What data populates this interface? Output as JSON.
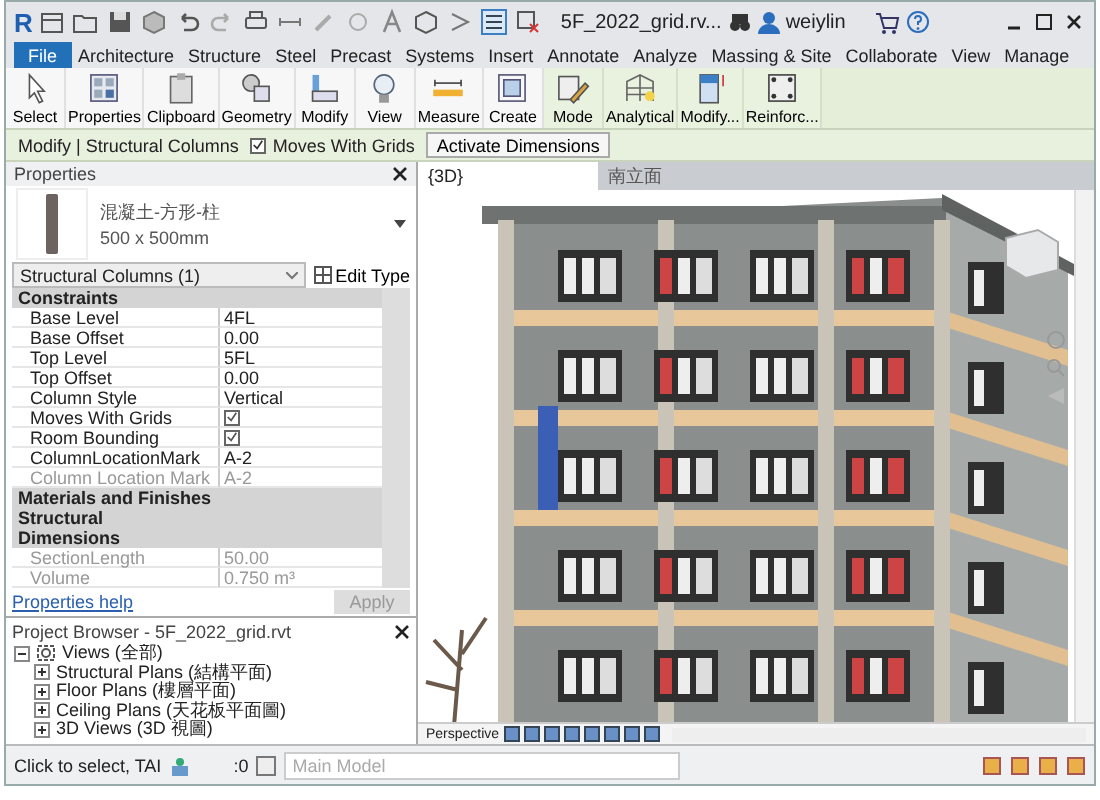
{
  "title_bar": {
    "logo": "R",
    "title": "5F_2022_grid.rv...",
    "user": "weiylin"
  },
  "ribbon_tabs": [
    {
      "label": "File",
      "kind": "file"
    },
    {
      "label": "Architecture",
      "kind": "tab"
    },
    {
      "label": "Structure",
      "kind": "tab"
    },
    {
      "label": "Steel",
      "kind": "tab"
    },
    {
      "label": "Precast",
      "kind": "tab"
    },
    {
      "label": "Systems",
      "kind": "tab"
    },
    {
      "label": "Insert",
      "kind": "tab"
    },
    {
      "label": "Annotate",
      "kind": "tab"
    },
    {
      "label": "Analyze",
      "kind": "tab"
    },
    {
      "label": "Massing & Site",
      "kind": "tab"
    },
    {
      "label": "Collaborate",
      "kind": "tab"
    },
    {
      "label": "View",
      "kind": "tab"
    },
    {
      "label": "Manage",
      "kind": "tab"
    }
  ],
  "ribbon_buttons": [
    {
      "label": "Select",
      "contextual": false
    },
    {
      "label": "Properties",
      "contextual": false
    },
    {
      "label": "Clipboard",
      "contextual": false
    },
    {
      "label": "Geometry",
      "contextual": false
    },
    {
      "label": "Modify",
      "contextual": false
    },
    {
      "label": "View",
      "contextual": false
    },
    {
      "label": "Measure",
      "contextual": false
    },
    {
      "label": "Create",
      "contextual": false
    },
    {
      "label": "Mode",
      "contextual": true
    },
    {
      "label": "Analytical",
      "contextual": true
    },
    {
      "label": "Modify...",
      "contextual": true
    },
    {
      "label": "Reinforc...",
      "contextual": true
    }
  ],
  "options_bar": {
    "context": "Modify | Structural Columns",
    "moves_with_grids": {
      "label": "Moves With Grids",
      "checked": true
    },
    "button": "Activate Dimensions"
  },
  "properties": {
    "title": "Properties",
    "type_name": "混凝土-方形-柱",
    "type_size": "500 x 500mm",
    "selector": "Structural Columns (1)",
    "edit_type": "Edit Type",
    "rows": [
      {
        "kind": "group",
        "label": "Constraints"
      },
      {
        "kind": "text",
        "label": "Base Level",
        "value": "4FL",
        "disabled": false
      },
      {
        "kind": "text",
        "label": "Base Offset",
        "value": "0.00",
        "disabled": false
      },
      {
        "kind": "text",
        "label": "Top Level",
        "value": "5FL",
        "disabled": false
      },
      {
        "kind": "text",
        "label": "Top Offset",
        "value": "0.00",
        "disabled": false
      },
      {
        "kind": "text",
        "label": "Column Style",
        "value": "Vertical",
        "disabled": false
      },
      {
        "kind": "check",
        "label": "Moves With Grids",
        "checked": true,
        "disabled": false
      },
      {
        "kind": "check",
        "label": "Room Bounding",
        "checked": true,
        "disabled": false
      },
      {
        "kind": "text",
        "label": "ColumnLocationMark",
        "value": "A-2",
        "disabled": false
      },
      {
        "kind": "text",
        "label": "Column Location Mark",
        "value": "A-2",
        "disabled": true
      },
      {
        "kind": "group",
        "label": "Materials and Finishes"
      },
      {
        "kind": "group",
        "label": "Structural"
      },
      {
        "kind": "group",
        "label": "Dimensions"
      },
      {
        "kind": "text",
        "label": "SectionLength",
        "value": "50.00",
        "disabled": true
      },
      {
        "kind": "text",
        "label": "Volume",
        "value": "0.750 m³",
        "disabled": true
      }
    ],
    "help": "Properties help",
    "apply": {
      "label": "Apply",
      "disabled": true
    }
  },
  "project_browser": {
    "title": "Project Browser - 5F_2022_grid.rvt",
    "tree": [
      {
        "label": "Views (全部)",
        "expanded": true,
        "children": [
          {
            "label": "Structural Plans (結構平面)",
            "expanded": false
          },
          {
            "label": "Floor Plans (樓層平面)",
            "expanded": false
          },
          {
            "label": "Ceiling Plans (天花板平面圖)",
            "expanded": false
          },
          {
            "label": "3D Views (3D 視圖)",
            "expanded": false
          }
        ]
      }
    ]
  },
  "view_tabs": [
    {
      "label": "{3D}",
      "selected": true
    },
    {
      "label": "南立面",
      "selected": false
    }
  ],
  "view_control": {
    "label": "Perspective"
  },
  "status_bar": {
    "hint": "Click to select, TAI",
    "count": ":0",
    "model": "Main Model"
  }
}
